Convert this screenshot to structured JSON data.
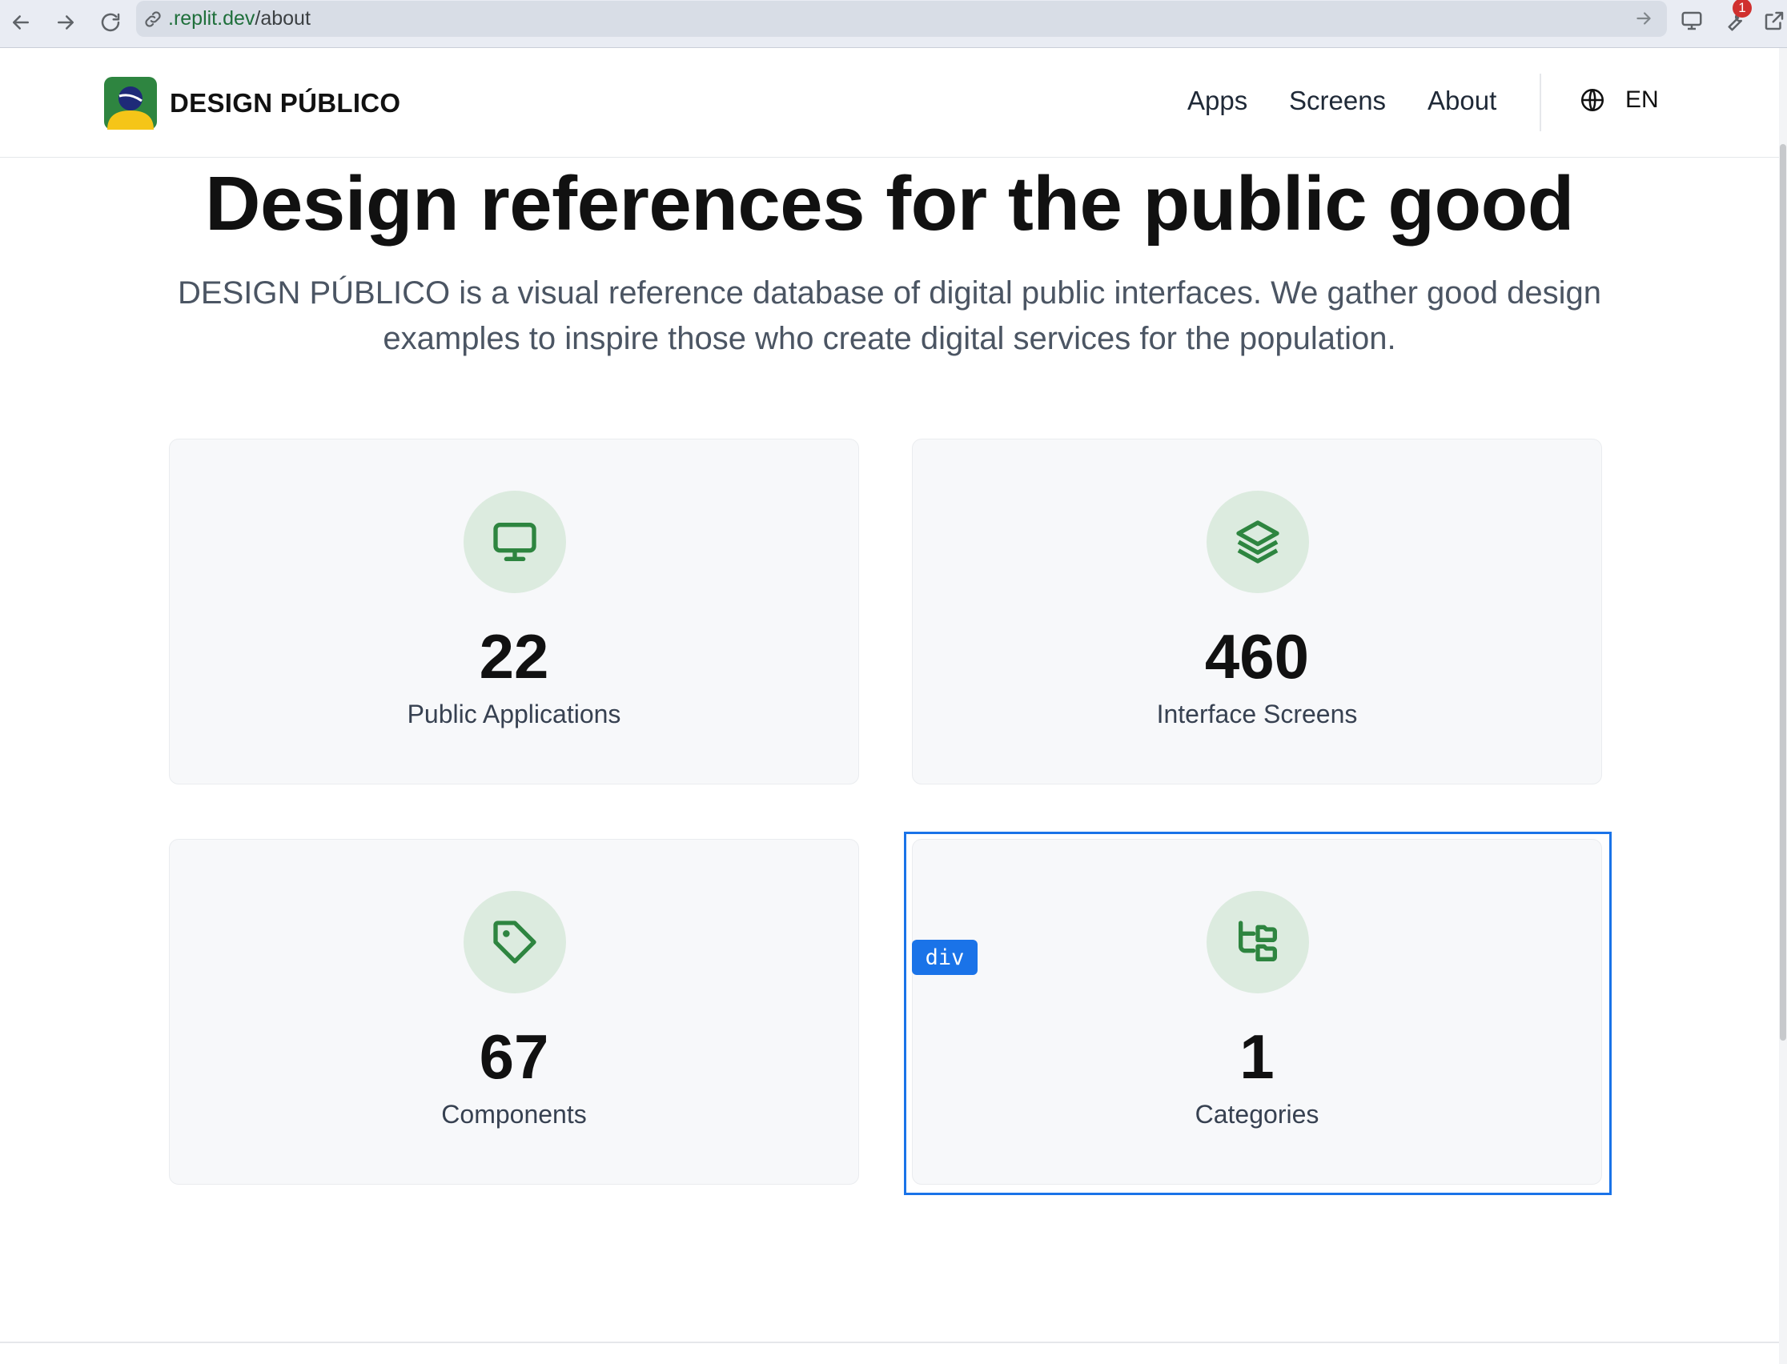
{
  "browser": {
    "url_host": ".replit.dev",
    "url_path": "/about",
    "extensions_badge": "1"
  },
  "header": {
    "brand_part1": "DESIGN",
    "brand_part2": "PÚBLICO",
    "nav": [
      "Apps",
      "Screens",
      "About"
    ],
    "language": "EN"
  },
  "hero": {
    "title": "Design references for the public good",
    "subtitle": "DESIGN PÚBLICO is a visual reference database of digital public interfaces. We gather good design examples to inspire those who create digital services for the population."
  },
  "stats": [
    {
      "icon": "monitor-icon",
      "value": "22",
      "label": "Public Applications"
    },
    {
      "icon": "layers-icon",
      "value": "460",
      "label": "Interface Screens"
    },
    {
      "icon": "tag-icon",
      "value": "67",
      "label": "Components"
    },
    {
      "icon": "folder-tree-icon",
      "value": "1",
      "label": "Categories"
    }
  ],
  "devtools": {
    "element_tag": "div"
  },
  "colors": {
    "accent_green": "#2e8540",
    "icon_bg": "#dcebdf",
    "card_bg": "#f7f8fa",
    "selection_blue": "#1a73e8"
  }
}
